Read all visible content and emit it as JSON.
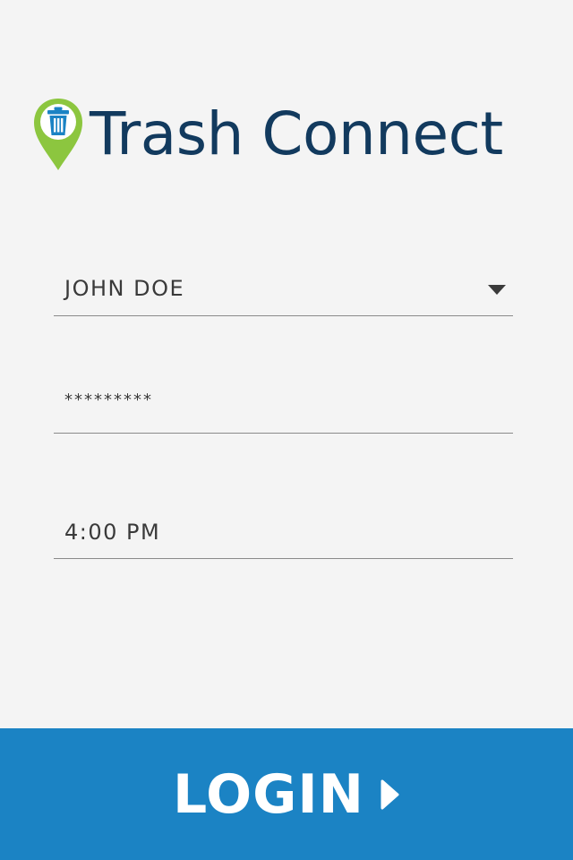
{
  "app": {
    "title": "Trash Connect"
  },
  "form": {
    "user_value": "JOHN DOE",
    "password_value": "*********",
    "time_value": "4:00 PM"
  },
  "login": {
    "label": "LOGIN"
  },
  "colors": {
    "brand_navy": "#123a5e",
    "pin_green": "#8cc63f",
    "accent_blue": "#1b83c4",
    "background": "#f4f4f4"
  },
  "icons": {
    "logo": "map-pin-trash-icon",
    "dropdown": "caret-down-icon",
    "login": "play-arrow-icon"
  }
}
